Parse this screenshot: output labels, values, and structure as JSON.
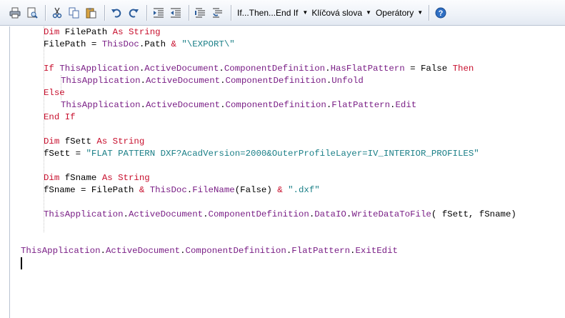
{
  "toolbar": {
    "menus": {
      "ifthen": "If...Then...End If",
      "keywords": "Klíčová slova",
      "operators": "Operátory"
    },
    "icons": [
      "print-icon",
      "print-preview-icon",
      "cut-icon",
      "copy-icon",
      "paste-icon",
      "undo-icon",
      "redo-icon",
      "indent-icon",
      "outdent-icon",
      "comment-icon",
      "uncomment-icon",
      "help-icon"
    ]
  },
  "code": {
    "l1": {
      "a": "Dim",
      "b": " FilePath ",
      "c": "As String"
    },
    "l2": {
      "a": "FilePath = ",
      "b": "ThisDoc",
      "c": ".Path ",
      "d": "&",
      "e": " ",
      "f": "\"\\EXPORT\\\""
    },
    "l4": {
      "a": "If",
      "b": " ",
      "c": "ThisApplication",
      "d": ".",
      "e": "ActiveDocument",
      "f": ".",
      "g": "ComponentDefinition",
      "h": ".",
      "i": "HasFlatPattern",
      "j": " = False ",
      "k": "Then"
    },
    "l5": {
      "a": "ThisApplication",
      "b": ".",
      "c": "ActiveDocument",
      "d": ".",
      "e": "ComponentDefinition",
      "f": ".",
      "g": "Unfold"
    },
    "l6": {
      "a": "Else"
    },
    "l7": {
      "a": "ThisApplication",
      "b": ".",
      "c": "ActiveDocument",
      "d": ".",
      "e": "ComponentDefinition",
      "f": ".",
      "g": "FlatPattern",
      "h": ".",
      "i": "Edit"
    },
    "l8": {
      "a": "End If"
    },
    "l10": {
      "a": "Dim",
      "b": " fSett ",
      "c": "As String"
    },
    "l11": {
      "a": "fSett = ",
      "b": "\"FLAT PATTERN DXF?AcadVersion=2000&OuterProfileLayer=IV_INTERIOR_PROFILES\""
    },
    "l13": {
      "a": "Dim",
      "b": " fSname ",
      "c": "As String"
    },
    "l14": {
      "a": "fSname = FilePath ",
      "b": "&",
      "c": " ",
      "d": "ThisDoc",
      "e": ".",
      "f": "FileName",
      "g": "(False) ",
      "h": "&",
      "i": " ",
      "j": "\".dxf\""
    },
    "l16": {
      "a": "ThisApplication",
      "b": ".",
      "c": "ActiveDocument",
      "d": ".",
      "e": "ComponentDefinition",
      "f": ".",
      "g": "DataIO",
      "h": ".",
      "i": "WriteDataToFile",
      "j": "( fSett, fSname)"
    },
    "l19": {
      "a": "ThisApplication",
      "b": ".",
      "c": "ActiveDocument",
      "d": ".",
      "e": "ComponentDefinition",
      "f": ".",
      "g": "FlatPattern",
      "h": ".",
      "i": "ExitEdit"
    }
  }
}
